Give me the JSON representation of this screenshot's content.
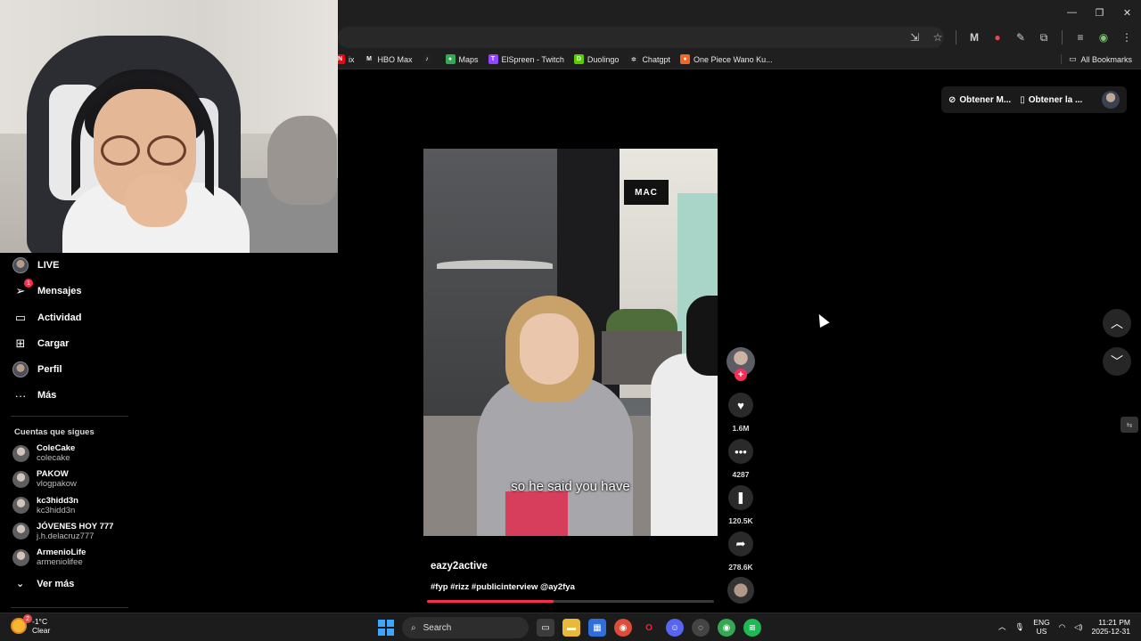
{
  "browser": {
    "window_controls": [
      "—",
      "❐",
      "✕"
    ],
    "toolbar_icons": [
      "install-app-icon",
      "star-icon",
      "extension-m-icon",
      "extension-red-icon",
      "extension-pin-icon",
      "puzzle-icon",
      "media-icon",
      "profile-icon",
      "menu-icon"
    ],
    "bookmarks": [
      {
        "label": "ix",
        "icon": "N",
        "color": "#e50914"
      },
      {
        "label": "HBO Max",
        "icon": "M",
        "color": "#222222"
      },
      {
        "label": "",
        "icon": "♪",
        "color": "#222222"
      },
      {
        "label": "Maps",
        "icon": "●",
        "color": "#34a853"
      },
      {
        "label": "ElSpreen - Twitch",
        "icon": "T",
        "color": "#9146ff"
      },
      {
        "label": "Duolingo",
        "icon": "D",
        "color": "#58cc02"
      },
      {
        "label": "Chatgpt",
        "icon": "✲",
        "color": "#222222"
      },
      {
        "label": "One Piece Wano Ku...",
        "icon": "●",
        "color": "#f26522"
      }
    ],
    "all_bookmarks": "All Bookmarks"
  },
  "sidebar": {
    "items": [
      {
        "label": "LIVE",
        "icon": "live-icon"
      },
      {
        "label": "Mensajes",
        "icon": "send-icon",
        "badge": "1"
      },
      {
        "label": "Actividad",
        "icon": "activity-icon"
      },
      {
        "label": "Cargar",
        "icon": "upload-icon"
      },
      {
        "label": "Perfil",
        "icon": "profile-icon"
      },
      {
        "label": "Más",
        "icon": "more-icon"
      }
    ],
    "following_title": "Cuentas que sigues",
    "following": [
      {
        "name": "ColeCake",
        "handle": "colecake"
      },
      {
        "name": "PAKOW",
        "handle": "vlogpakow"
      },
      {
        "name": "kc3hidd3n",
        "handle": "kc3hidd3n"
      },
      {
        "name": "JÓVENES HOY 777",
        "handle": "j.h.delacruz777"
      },
      {
        "name": "ArmenioLife",
        "handle": "armeniolifee"
      }
    ],
    "see_more": "Ver más"
  },
  "top_actions": {
    "coins_label": "Obtener M...",
    "app_label": "Obtener la ..."
  },
  "video": {
    "store_sign": "MAC",
    "caption": "so he said you have",
    "username": "eazy2active",
    "tags": "#fyp #rizz #publicinterview @ay2fya",
    "progress": 0.44
  },
  "rail": {
    "likes": "1.6M",
    "comments": "4287",
    "saves": "120.5K",
    "shares": "278.6K"
  },
  "taskbar": {
    "temp": "-1°C",
    "condition": "Clear",
    "weather_badge": "2",
    "search_placeholder": "Search",
    "lang": "ENG",
    "region": "US",
    "time": "11:21 PM",
    "date": "2025-12-31"
  },
  "colors": {
    "accent": "#fe2c55",
    "background": "#000000",
    "chrome": "#1f1f1f"
  }
}
